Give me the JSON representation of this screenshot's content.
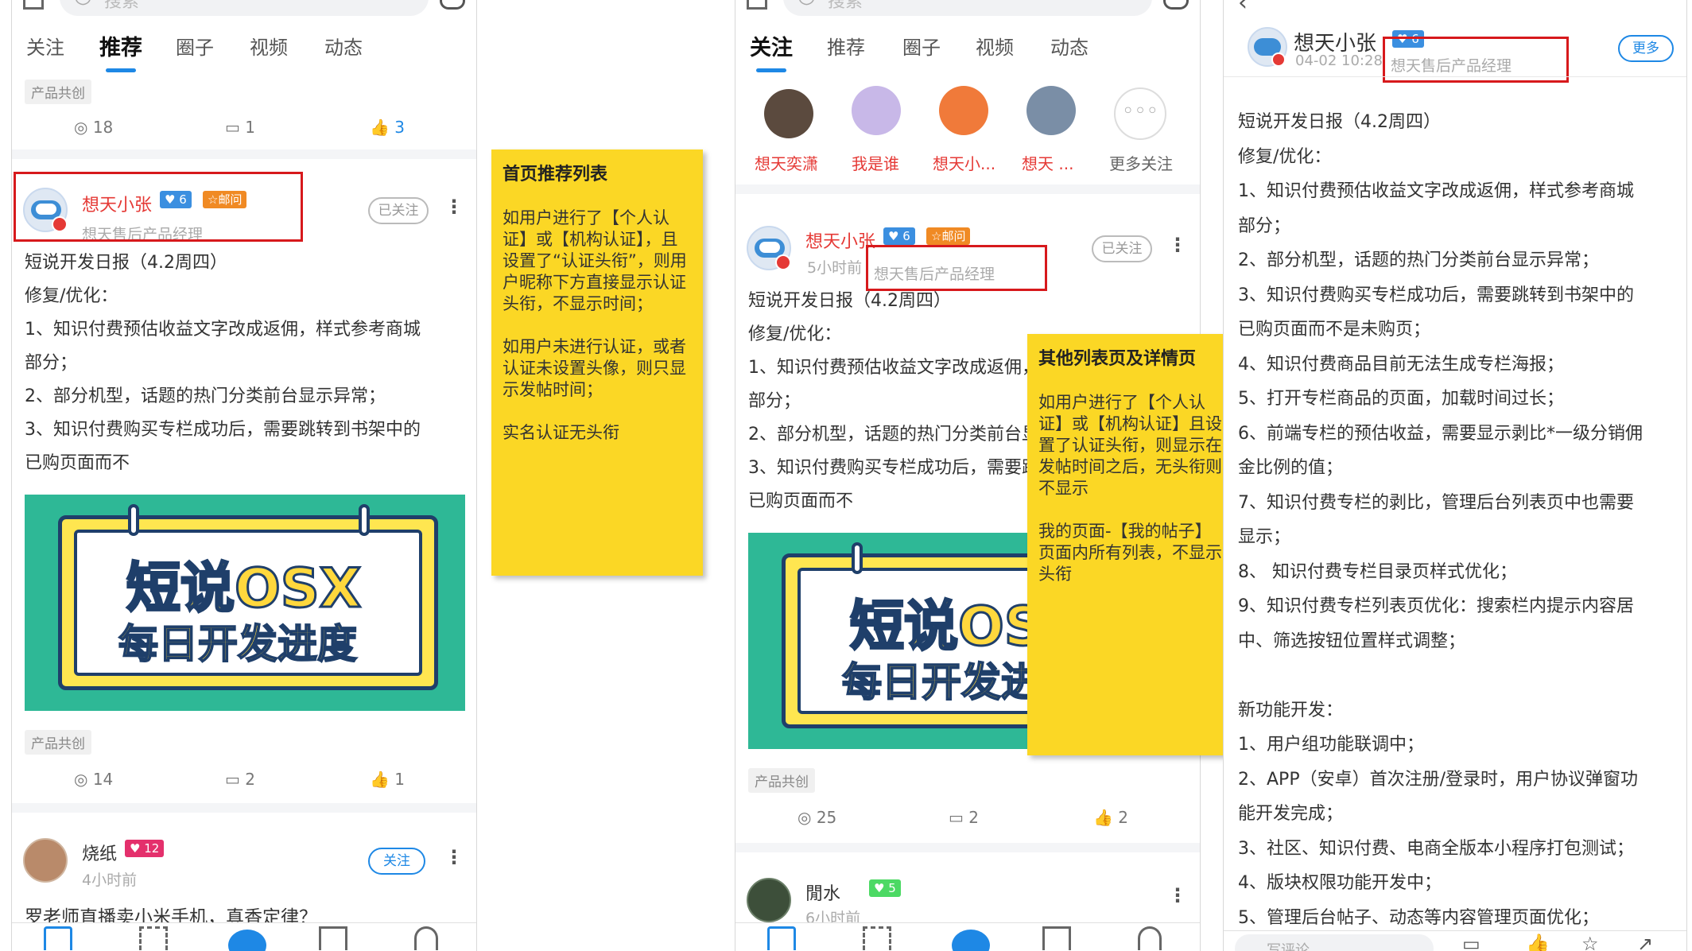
{
  "common": {
    "search_placeholder": "搜索",
    "tabs": [
      "关注",
      "推荐",
      "圈子",
      "视频",
      "动态"
    ],
    "tag": "产品共创",
    "post_user": "想天小张",
    "post_user_level": "6",
    "post_user_badge": "☆邮问",
    "cert_title": "想天售后产品经理",
    "following_label": "已关注",
    "follow_label": "关注",
    "post_body": [
      "短说开发日报（4.2周四）",
      "修复/优化：",
      "1、知识付费预估收益文字改成返佣，样式参考商城",
      "部分；",
      "2、部分机型，话题的热门分类前台显示异常；",
      "3、知识付费购买专栏成功后，需要跳转到书架中的",
      "已购页面而不"
    ],
    "banner_title": "短说OSX",
    "banner_subtitle": "每日开发进度"
  },
  "phone1": {
    "top_stats": {
      "views": "18",
      "comments": "1",
      "likes": "3"
    },
    "post_stats": {
      "views": "14",
      "comments": "2",
      "likes": "1"
    },
    "next_user": "烧纸",
    "next_level": "12",
    "next_time": "4小时前",
    "next_title": "罗老师直播卖小米手机，真香定律？"
  },
  "note1": {
    "title": "首页推荐列表",
    "p1": "如用户进行了【个人认证】或【机构认证】，且设置了“认证头衔”，则用户昵称下方直接显示认证头衔，不显示时间；",
    "p2": "如用户未进行认证，或者认证未设置头像，则只显示发帖时间；",
    "p3": "实名认证无头衔"
  },
  "phone2": {
    "stories": [
      "想天奕潇",
      "我是谁",
      "想天小...",
      "想天 ..."
    ],
    "more_follow": "更多关注",
    "time": "5小时前",
    "post_stats": {
      "views": "25",
      "comments": "2",
      "likes": "2"
    },
    "next_user": "閒水",
    "next_level": "5",
    "next_time": "6小时前"
  },
  "note2": {
    "title": "其他列表页及详情页",
    "p1": "如用户进行了【个人认证】或【机构认证】且设置了认证头衔，则显示在发帖时间之后，无头衔则不显示",
    "p2": "我的页面-【我的帖子】页面内所有列表，不显示头衔"
  },
  "phone3": {
    "user": "想天小张",
    "time": "04-02 10:28",
    "more_btn": "更多",
    "lines": [
      "短说开发日报（4.2周四）",
      "修复/优化：",
      "1、知识付费预估收益文字改成返佣，样式参考商城",
      "部分；",
      "2、部分机型，话题的热门分类前台显示异常；",
      "3、知识付费购买专栏成功后，需要跳转到书架中的",
      "已购页面而不是未购页；",
      "4、知识付费商品目前无法生成专栏海报；",
      "5、打开专栏商品的页面，加载时间过长；",
      "6、前端专栏的预估收益，需要显示剥比*一级分销佣",
      "金比例的值；",
      "7、知识付费专栏的剥比，管理后台列表页中也需要",
      "显示；",
      "8、 知识付费专栏目录页样式优化；",
      "9、知识付费专栏列表页优化：搜索栏内提示内容居",
      "中、筛选按钮位置样式调整；",
      "",
      "新功能开发：",
      "1、用户组功能联调中；",
      "2、APP（安卓）首次注册/登录时，用户协议弹窗功",
      "能开发完成；",
      "3、社区、知识付费、电商全版本小程序打包测试；",
      "4、版块权限功能开发中；",
      "5、管理后台帖子、动态等内容管理页面优化；"
    ],
    "comment_placeholder": "写评论"
  }
}
